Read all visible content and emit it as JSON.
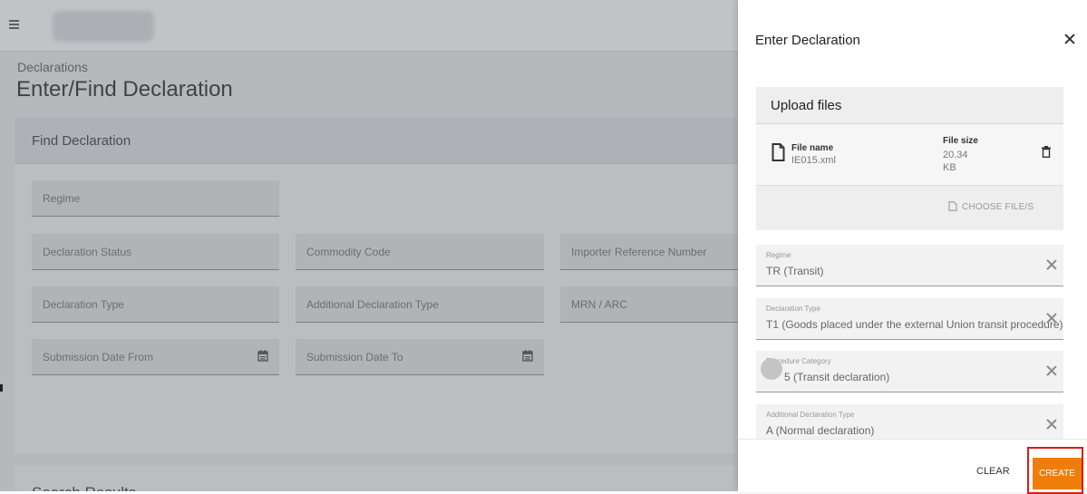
{
  "main": {
    "breadcrumb": "Declarations",
    "page_title": "Enter/Find Declaration",
    "find_panel_title": "Find Declaration",
    "fields": {
      "regime": "Regime",
      "declaration_status": "Declaration Status",
      "commodity_code": "Commodity Code",
      "importer_reference_number": "Importer Reference Number",
      "declaration_type": "Declaration Type",
      "additional_declaration_type": "Additional Declaration Type",
      "mrn_arc": "MRN / ARC",
      "submission_date_from": "Submission Date From",
      "submission_date_to": "Submission Date To"
    },
    "results_title": "Search Results"
  },
  "drawer": {
    "title": "Enter Declaration",
    "upload": {
      "title": "Upload files",
      "file_name_label": "File name",
      "file_name": "IE015.xml",
      "file_size_label": "File size",
      "file_size": "20.34 KB",
      "choose_files": "CHOOSE FILE/S"
    },
    "fields": [
      {
        "label": "Regime",
        "value": "TR (Transit)"
      },
      {
        "label": "Declaration Type",
        "value": "T1 (Goods placed under the external Union transit procedure)"
      },
      {
        "label": "Procedure Category",
        "value": "5 (Transit declaration)"
      },
      {
        "label": "Additional Declaration Type",
        "value": "A (Normal declaration)"
      }
    ],
    "footer": {
      "clear": "CLEAR",
      "create": "CREATE"
    }
  },
  "colors": {
    "accent": "#ef7d0a",
    "highlight": "#d81c1c"
  },
  "icons": [
    "menu-icon",
    "calendar-icon",
    "close-icon",
    "file-icon",
    "trash-icon",
    "choose-file-icon",
    "clear-icon"
  ]
}
